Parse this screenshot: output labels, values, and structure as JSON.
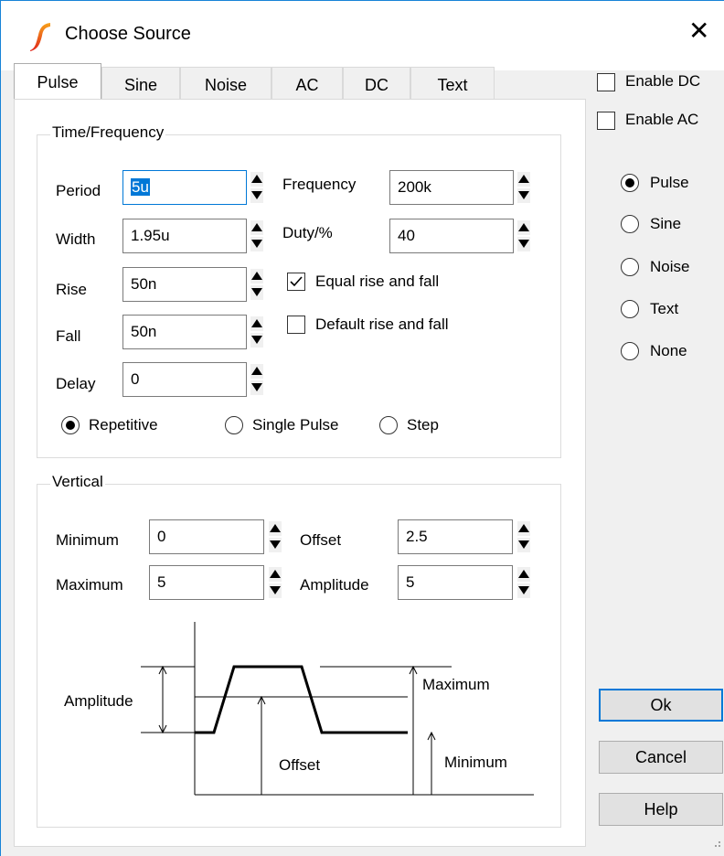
{
  "window": {
    "title": "Choose Source",
    "close_label": "✕"
  },
  "tabs": [
    {
      "label": "Pulse",
      "active": true
    },
    {
      "label": "Sine"
    },
    {
      "label": "Noise"
    },
    {
      "label": "AC"
    },
    {
      "label": "DC"
    },
    {
      "label": "Text"
    }
  ],
  "time_freq": {
    "group_label": "Time/Frequency",
    "period": {
      "label": "Period",
      "value": "5u"
    },
    "width": {
      "label": "Width",
      "value": "1.95u"
    },
    "rise": {
      "label": "Rise",
      "value": "50n"
    },
    "fall": {
      "label": "Fall",
      "value": "50n"
    },
    "delay": {
      "label": "Delay",
      "value": "0"
    },
    "frequency": {
      "label": "Frequency",
      "value": "200k"
    },
    "duty": {
      "label": "Duty/%",
      "value": "40"
    },
    "equal_rise_fall": {
      "label": "Equal rise and fall",
      "checked": true
    },
    "default_rise_fall": {
      "label": "Default rise and fall",
      "checked": false
    },
    "mode_options": [
      {
        "label": "Repetitive",
        "selected": true
      },
      {
        "label": "Single Pulse",
        "selected": false
      },
      {
        "label": "Step",
        "selected": false
      }
    ]
  },
  "vertical": {
    "group_label": "Vertical",
    "minimum": {
      "label": "Minimum",
      "value": "0"
    },
    "maximum": {
      "label": "Maximum",
      "value": "5"
    },
    "offset": {
      "label": "Offset",
      "value": "2.5"
    },
    "amplitude": {
      "label": "Amplitude",
      "value": "5"
    },
    "diagram": {
      "amplitude_label": "Amplitude",
      "offset_label": "Offset",
      "maximum_label": "Maximum",
      "minimum_label": "Minimum"
    }
  },
  "right": {
    "enable_dc": {
      "label": "Enable DC",
      "checked": false
    },
    "enable_ac": {
      "label": "Enable AC",
      "checked": false
    },
    "source_types": [
      {
        "label": "Pulse",
        "selected": true
      },
      {
        "label": "Sine",
        "selected": false
      },
      {
        "label": "Noise",
        "selected": false
      },
      {
        "label": "Text",
        "selected": false
      },
      {
        "label": "None",
        "selected": false
      }
    ]
  },
  "buttons": {
    "ok": "Ok",
    "cancel": "Cancel",
    "help": "Help"
  },
  "colors": {
    "accent": "#0078d7",
    "logo_red": "#e0241b",
    "logo_orange": "#f7a21b"
  }
}
